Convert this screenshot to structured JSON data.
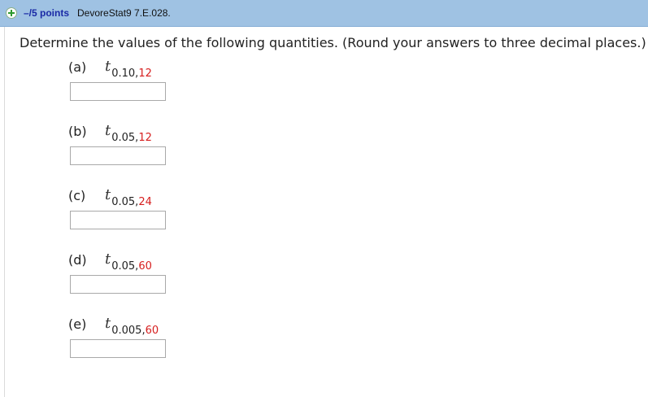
{
  "header": {
    "points_label": "–/5 points",
    "source_label": "DevoreStat9 7.E.028."
  },
  "question": {
    "instructions": "Determine the values of the following quantities. (Round your answers to three decimal places.)",
    "parts": [
      {
        "label": "(a)",
        "symbol": "t",
        "alpha": "0.10,",
        "df": "12",
        "answer_value": ""
      },
      {
        "label": "(b)",
        "symbol": "t",
        "alpha": "0.05,",
        "df": "12",
        "answer_value": ""
      },
      {
        "label": "(c)",
        "symbol": "t",
        "alpha": "0.05,",
        "df": "24",
        "answer_value": ""
      },
      {
        "label": "(d)",
        "symbol": "t",
        "alpha": "0.05,",
        "df": "60",
        "answer_value": ""
      },
      {
        "label": "(e)",
        "symbol": "t",
        "alpha": "0.005,",
        "df": "60",
        "answer_value": ""
      }
    ]
  },
  "colors": {
    "header_background": "#9fc2e3",
    "points_text": "#1a2aa6",
    "degrees_of_freedom": "#d61e1e",
    "plus_icon": "#2e9a2e"
  }
}
